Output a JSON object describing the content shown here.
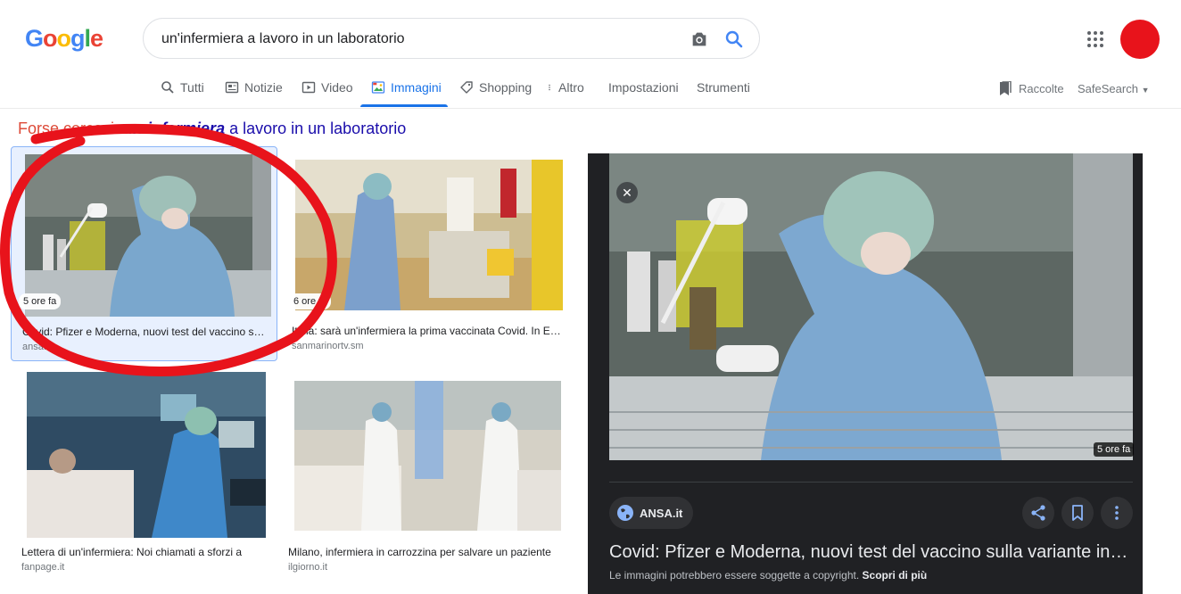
{
  "logo": "Google",
  "search": {
    "query": "un'infermiera a lavoro in un laboratorio"
  },
  "tabs": [
    {
      "label": "Tutti"
    },
    {
      "label": "Notizie"
    },
    {
      "label": "Video"
    },
    {
      "label": "Immagini",
      "active": true
    },
    {
      "label": "Shopping"
    },
    {
      "label": "Altro"
    },
    {
      "label": "Impostazioni"
    },
    {
      "label": "Strumenti"
    }
  ],
  "toolbar": {
    "raccolte": "Raccolte",
    "safesearch": "SafeSearch"
  },
  "suggestion": {
    "prefix": "Forse cercavi:",
    "highlight": "un infermiera",
    "rest": "a lavoro in un laboratorio"
  },
  "results": [
    {
      "badge": "5 ore fa",
      "caption": "Covid: Pfizer e Moderna, nuovi test del vaccino sulla variante inglese",
      "source": "ansa.it"
    },
    {
      "badge": "6 ore fa",
      "caption": "Italia: sarà un'infermiera la prima vaccinata Covid. In Europa",
      "source": "sanmarinortv.sm"
    },
    {
      "caption": "Lettera di un'infermiera: Noi chiamati a sforzi a",
      "source": "fanpage.it"
    },
    {
      "caption": "Milano, infermiera in carrozzina per salvare un paziente",
      "source": "ilgiorno.it"
    }
  ],
  "panel": {
    "badge": "5 ore fa",
    "site": "ANSA.it",
    "title": "Covid: Pfizer e Moderna, nuovi test del vaccino sulla variante inglese",
    "copyright": "Le immagini potrebbero essere soggette a copyright.",
    "learn_more": "Scopri di più"
  },
  "colors": {
    "accent": "#1a73e8",
    "annotation": "#e8131b",
    "panel_bg": "#202124"
  }
}
